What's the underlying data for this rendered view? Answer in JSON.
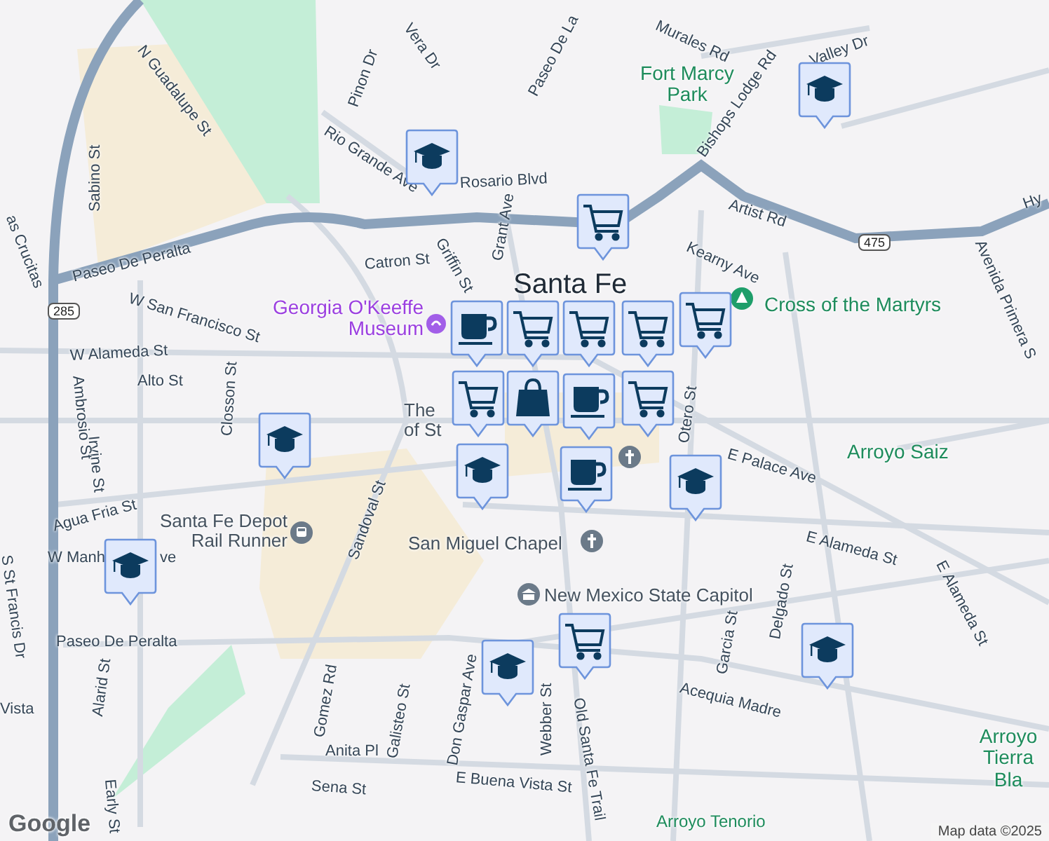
{
  "map": {
    "labels": [
      {
        "kind": "street",
        "text": "N Guadalupe St"
      },
      {
        "kind": "street",
        "text": "Paseo De Peralta"
      },
      {
        "kind": "street",
        "text": "W San Francisco St"
      },
      {
        "kind": "street",
        "text": "W Alameda St"
      },
      {
        "kind": "street",
        "text": "Alto St"
      },
      {
        "kind": "street",
        "text": "Catron St"
      },
      {
        "kind": "street",
        "text": "Griffin St"
      },
      {
        "kind": "street",
        "text": "Grant Ave"
      },
      {
        "kind": "street",
        "text": "Rio Grande Ave"
      },
      {
        "kind": "street",
        "text": "Rosario Blvd"
      },
      {
        "kind": "street",
        "text": "Pinon Dr"
      },
      {
        "kind": "street",
        "text": "Vera Dr"
      },
      {
        "kind": "street",
        "text": "Sabino St"
      },
      {
        "kind": "street",
        "text": "as Crucitas"
      },
      {
        "kind": "street",
        "text": "Murales Rd"
      },
      {
        "kind": "street",
        "text": "Paseo De La"
      },
      {
        "kind": "street",
        "text": "Bishops Lodge Rd"
      },
      {
        "kind": "street",
        "text": "Valley Dr"
      },
      {
        "kind": "street",
        "text": "Artist Rd"
      },
      {
        "kind": "street",
        "text": "Kearny Ave"
      },
      {
        "kind": "street",
        "text": "Otero St"
      },
      {
        "kind": "street",
        "text": "Avenida Primera S"
      },
      {
        "kind": "street",
        "text": "E Palace Ave"
      },
      {
        "kind": "street",
        "text": "E Alameda St"
      },
      {
        "kind": "street",
        "text": "E Alameda St"
      },
      {
        "kind": "street",
        "text": "Delgado St"
      },
      {
        "kind": "street",
        "text": "Garcia St"
      },
      {
        "kind": "street",
        "text": "Acequia Madre"
      },
      {
        "kind": "street",
        "text": "Old Santa Fe Trail"
      },
      {
        "kind": "street",
        "text": "Webber St"
      },
      {
        "kind": "street",
        "text": "E Buena Vista St"
      },
      {
        "kind": "street",
        "text": "Don Gaspar Ave"
      },
      {
        "kind": "street",
        "text": "Galisteo St"
      },
      {
        "kind": "street",
        "text": "Gomez Rd"
      },
      {
        "kind": "street",
        "text": "Anita Pl"
      },
      {
        "kind": "street",
        "text": "Sena St"
      },
      {
        "kind": "street",
        "text": "W Manh"
      },
      {
        "kind": "street",
        "text": "ve"
      },
      {
        "kind": "street",
        "text": "Paseo De Peralta"
      },
      {
        "kind": "street",
        "text": "Agua Fria St"
      },
      {
        "kind": "street",
        "text": "Sandoval St"
      },
      {
        "kind": "street",
        "text": "Alarid St"
      },
      {
        "kind": "street",
        "text": "Early St"
      },
      {
        "kind": "street",
        "text": "S St Francis Dr"
      },
      {
        "kind": "street",
        "text": "Irvine St"
      },
      {
        "kind": "street",
        "text": "Ambrosio St"
      },
      {
        "kind": "street",
        "text": "Closson St"
      },
      {
        "kind": "street",
        "text": "Vista"
      },
      {
        "kind": "street",
        "text": "Hy"
      },
      {
        "kind": "park",
        "text": "Fort Marcy Park"
      },
      {
        "kind": "park",
        "text": "Cross of the Martyrs"
      },
      {
        "kind": "park",
        "text": "Arroyo Saiz"
      },
      {
        "kind": "park",
        "text": "Arroyo Tierra Bla"
      },
      {
        "kind": "park",
        "text": "Arroyo Tenorio"
      },
      {
        "kind": "museum",
        "text": "Georgia O'Keeffe Museum"
      },
      {
        "kind": "city",
        "text": "Santa Fe"
      },
      {
        "kind": "place",
        "text": "Santa Fe Depot Rail Runner"
      },
      {
        "kind": "place",
        "text": "San Miguel Chapel"
      },
      {
        "kind": "place",
        "text": "New Mexico State Capitol"
      },
      {
        "kind": "place",
        "text": "The"
      },
      {
        "kind": "place",
        "text": "of St"
      }
    ],
    "shields": [
      "285",
      "475"
    ],
    "markers": [
      {
        "kind": "school"
      },
      {
        "kind": "school"
      },
      {
        "kind": "school"
      },
      {
        "kind": "school"
      },
      {
        "kind": "school"
      },
      {
        "kind": "school"
      },
      {
        "kind": "school"
      },
      {
        "kind": "school"
      },
      {
        "kind": "cart"
      },
      {
        "kind": "cart"
      },
      {
        "kind": "cart"
      },
      {
        "kind": "cart"
      },
      {
        "kind": "cart"
      },
      {
        "kind": "cart"
      },
      {
        "kind": "cart"
      },
      {
        "kind": "cart"
      },
      {
        "kind": "coffee"
      },
      {
        "kind": "coffee"
      },
      {
        "kind": "coffee"
      },
      {
        "kind": "bag"
      }
    ],
    "logo": "Google",
    "attribution": "Map data ©2025"
  }
}
